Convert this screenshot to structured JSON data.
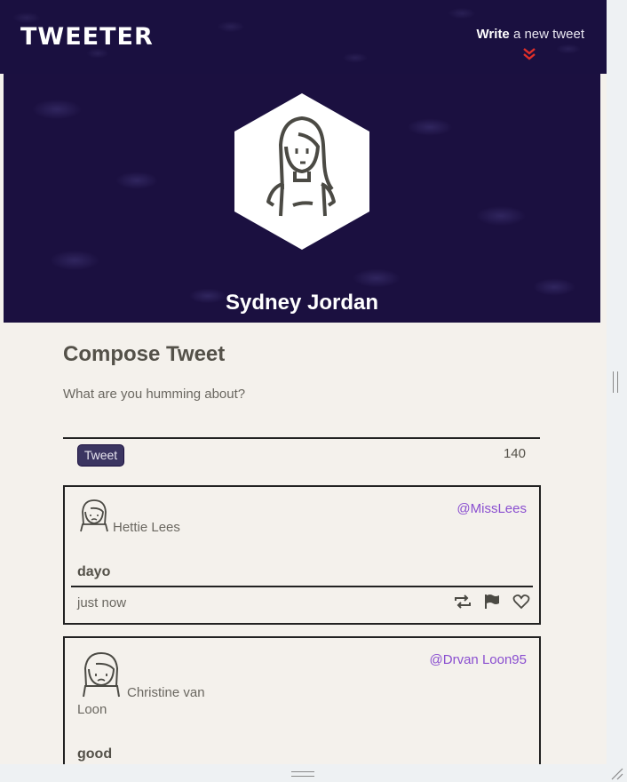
{
  "nav": {
    "logo": "TWEETER",
    "write_bold": "Write",
    "write_rest": " a new tweet",
    "chevron_color": "#e0302a"
  },
  "profile": {
    "name": "Sydney Jordan",
    "avatar_icon": "woman-long-hair-avatar-icon"
  },
  "compose": {
    "title": "Compose Tweet",
    "placeholder": "What are you humming about?",
    "button_label": "Tweet",
    "counter": "140"
  },
  "tweets": [
    {
      "name": "Hettie Lees",
      "handle": "@MissLees",
      "text": "dayo",
      "time": "just now",
      "avatar_icon": "woman-avatar-icon",
      "actions": [
        "retweet-icon",
        "flag-icon",
        "heart-icon"
      ]
    },
    {
      "name": "Christine van Loon",
      "handle": "@Drvan Loon95",
      "text": "good",
      "avatar_icon": "woman-avatar-icon"
    }
  ],
  "colors": {
    "nav_bg": "#1a1040",
    "page_bg": "#f4f1ec",
    "handle": "#8a4fd0",
    "text": "#545149"
  }
}
